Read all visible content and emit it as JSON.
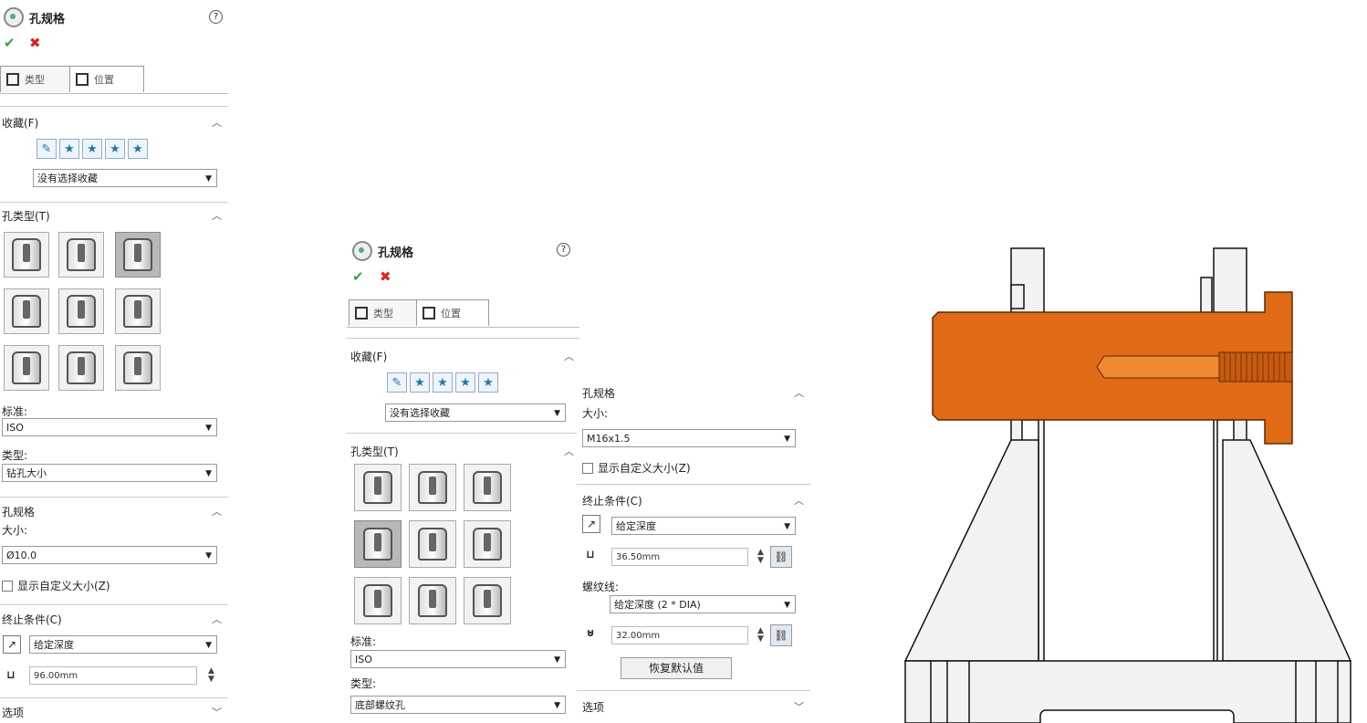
{
  "panel1": {
    "title": "孔规格",
    "help": "?",
    "tabs": [
      "类型",
      "位置"
    ],
    "favorites_header": "收藏(F)",
    "favorite_select": "没有选择收藏",
    "hole_type_header": "孔类型(T)",
    "standard_label": "标准:",
    "standard_value": "ISO",
    "type_label": "类型:",
    "type_value": "钻孔大小",
    "spec_header": "孔规格",
    "size_label": "大小:",
    "size_value": "Ø10.0",
    "custom_size_label": "显示自定义大小(Z)",
    "end_cond_header": "终止条件(C)",
    "end_cond_value": "给定深度",
    "depth_value": "96.00mm",
    "options_header": "选项"
  },
  "panel2": {
    "title": "孔规格",
    "help": "?",
    "tabs": [
      "类型",
      "位置"
    ],
    "favorites_header": "收藏(F)",
    "favorite_select": "没有选择收藏",
    "hole_type_header": "孔类型(T)",
    "standard_label": "标准:",
    "standard_value": "ISO",
    "type_label": "类型:",
    "type_value": "底部螺纹孔"
  },
  "panel3": {
    "spec_header": "孔规格",
    "size_label": "大小:",
    "size_value": "M16x1.5",
    "custom_size_label": "显示自定义大小(Z)",
    "end_cond_header": "终止条件(C)",
    "end_cond_value": "给定深度",
    "depth_value": "36.50mm",
    "thread_label": "螺纹线:",
    "thread_value": "给定深度 (2 * DIA)",
    "thread_depth_value": "32.00mm",
    "restore_button": "恢复默认值",
    "options_header": "选项"
  },
  "colors": {
    "part_orange": "#e06a16",
    "accent_green": "#3aa43a",
    "accent_red": "#dd2222"
  }
}
